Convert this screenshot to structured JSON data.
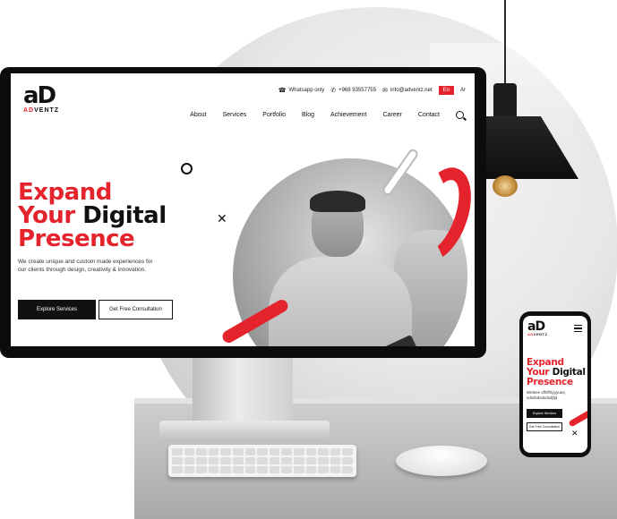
{
  "brand": {
    "mark": "aD",
    "word_prefix": "AD",
    "word_suffix": "VENTZ"
  },
  "topbar": {
    "whatsapp_label": "Whatsapp only",
    "phone": "+968 93557755",
    "email": "info@adventz.net",
    "lang_en": "En",
    "lang_ar": "Ar"
  },
  "nav": {
    "items": [
      "About",
      "Services",
      "Portfolio",
      "Blog",
      "Achievement",
      "Career",
      "Contact"
    ]
  },
  "hero": {
    "line1": "Expand",
    "line2_red": "Your",
    "line2_dark": "Digital",
    "line3": "Presence",
    "description": "We create unique and custom made experiences for our clients through design, creativity & innovation.",
    "primary_button": "Explore Services",
    "secondary_button": "Get Free Consultation"
  },
  "phone": {
    "line1": "Expand",
    "line2_red": "Your",
    "line2_dark": "Digital",
    "line3": "Presence",
    "description": "Wetsee sffsffrtyyyueq sdsdsdsdsdsdjfjd",
    "primary_button": "Explore Services",
    "secondary_button": "Get Free Consultation"
  },
  "colors": {
    "accent": "#e4232d",
    "dark": "#111111"
  },
  "icons": [
    "whatsapp-icon",
    "phone-icon",
    "mail-icon",
    "search-icon",
    "menu-icon",
    "close-icon"
  ]
}
